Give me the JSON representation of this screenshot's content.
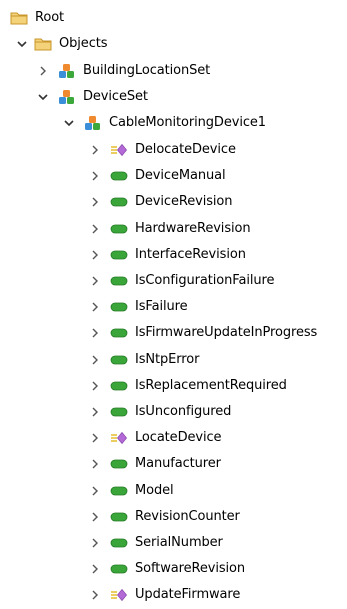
{
  "tree": {
    "root": {
      "label": "Root",
      "icon": "folder-icon"
    },
    "objects": {
      "label": "Objects",
      "icon": "folder-icon",
      "expanded": true
    },
    "building_location_set": {
      "label": "BuildingLocationSet",
      "icon": "object-set-icon",
      "expanded": false
    },
    "device_set": {
      "label": "DeviceSet",
      "icon": "object-set-icon",
      "expanded": true
    },
    "device": {
      "label": "CableMonitoringDevice1",
      "icon": "object-set-icon",
      "expanded": true
    },
    "children": [
      {
        "label": "DelocateDevice",
        "icon": "method-icon"
      },
      {
        "label": "DeviceManual",
        "icon": "variable-icon"
      },
      {
        "label": "DeviceRevision",
        "icon": "variable-icon"
      },
      {
        "label": "HardwareRevision",
        "icon": "variable-icon"
      },
      {
        "label": "InterfaceRevision",
        "icon": "variable-icon"
      },
      {
        "label": "IsConfigurationFailure",
        "icon": "variable-icon"
      },
      {
        "label": "IsFailure",
        "icon": "variable-icon"
      },
      {
        "label": "IsFirmwareUpdateInProgress",
        "icon": "variable-icon"
      },
      {
        "label": "IsNtpError",
        "icon": "variable-icon"
      },
      {
        "label": "IsReplacementRequired",
        "icon": "variable-icon"
      },
      {
        "label": "IsUnconfigured",
        "icon": "variable-icon"
      },
      {
        "label": "LocateDevice",
        "icon": "method-icon"
      },
      {
        "label": "Manufacturer",
        "icon": "variable-icon"
      },
      {
        "label": "Model",
        "icon": "variable-icon"
      },
      {
        "label": "RevisionCounter",
        "icon": "variable-icon"
      },
      {
        "label": "SerialNumber",
        "icon": "variable-icon"
      },
      {
        "label": "SoftwareRevision",
        "icon": "variable-icon"
      },
      {
        "label": "UpdateFirmware",
        "icon": "method-icon"
      }
    ]
  },
  "colors": {
    "folder": "#e8b84a",
    "variable": "#3aa63a",
    "method": "#b46ad6",
    "chevron": "#444444"
  }
}
